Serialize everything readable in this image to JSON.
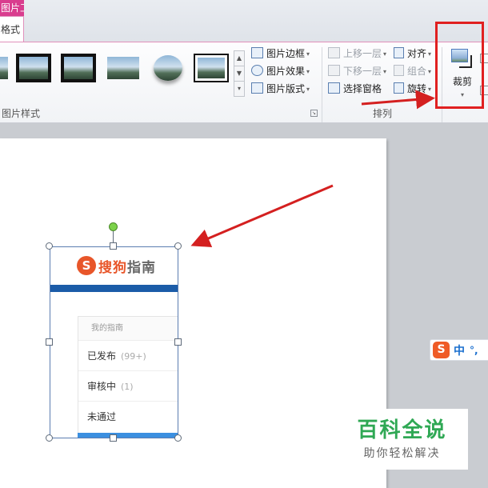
{
  "tabs": {
    "context_group": "图片工具",
    "active": "格式"
  },
  "gallery": {
    "group_label": "图片样式"
  },
  "picture_commands": [
    {
      "label": "图片边框",
      "icon": "pencil-border-icon"
    },
    {
      "label": "图片效果",
      "icon": "picture-effects-icon"
    },
    {
      "label": "图片版式",
      "icon": "picture-layout-icon"
    }
  ],
  "arrange": {
    "group_label": "排列",
    "commands": [
      {
        "label": "上移一层",
        "icon": "bring-forward-icon",
        "enabled": false
      },
      {
        "label": "下移一层",
        "icon": "send-backward-icon",
        "enabled": false
      },
      {
        "label": "选择窗格",
        "icon": "selection-pane-icon",
        "enabled": true
      },
      {
        "label": "对齐",
        "icon": "align-icon",
        "enabled": true
      },
      {
        "label": "组合",
        "icon": "group-icon",
        "enabled": false
      },
      {
        "label": "旋转",
        "icon": "rotate-icon",
        "enabled": true
      }
    ]
  },
  "crop": {
    "label": "裁剪",
    "icon": "crop-icon"
  },
  "picture": {
    "logo_icon_letter": "S",
    "logo_brand": "搜狗",
    "logo_suffix": "指南",
    "menu_title": "我的指南",
    "items": [
      {
        "label": "已发布",
        "count": "(99+)"
      },
      {
        "label": "审核中",
        "count": "(1)"
      },
      {
        "label": "未通过",
        "count": ""
      }
    ]
  },
  "ime": {
    "logo_letter": "S",
    "mode": "中",
    "punct": "°,"
  },
  "watermark": {
    "title": "百科全说",
    "subtitle": "助你轻松解决"
  },
  "colors": {
    "context_tab": "#d93d8e",
    "highlight": "#e02020",
    "arrow": "#d42020",
    "band": "#1b5ca8"
  }
}
